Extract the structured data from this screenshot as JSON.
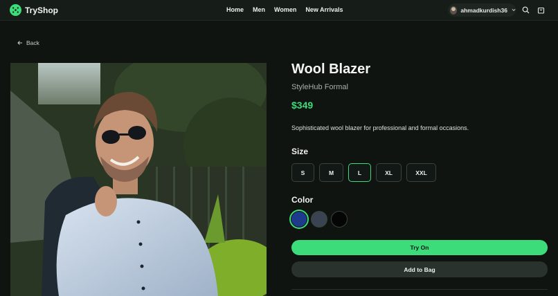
{
  "header": {
    "brand": "TryShop",
    "nav": [
      "Home",
      "Men",
      "Women",
      "New Arrivals"
    ],
    "username": "ahmadkurdish36"
  },
  "back_label": "Back",
  "product": {
    "title": "Wool Blazer",
    "brand": "StyleHub Formal",
    "price": "$349",
    "description": "Sophisticated wool blazer for professional and formal occasions.",
    "size_label": "Size",
    "sizes": [
      "S",
      "M",
      "L",
      "XL",
      "XXL"
    ],
    "selected_size": "L",
    "color_label": "Color",
    "colors": [
      "#1e3a8a",
      "#3a4352",
      "#050505"
    ],
    "selected_color": "#1e3a8a",
    "try_on_label": "Try On",
    "add_to_bag_label": "Add to Bag"
  },
  "accent_color": "#3ddc7a"
}
